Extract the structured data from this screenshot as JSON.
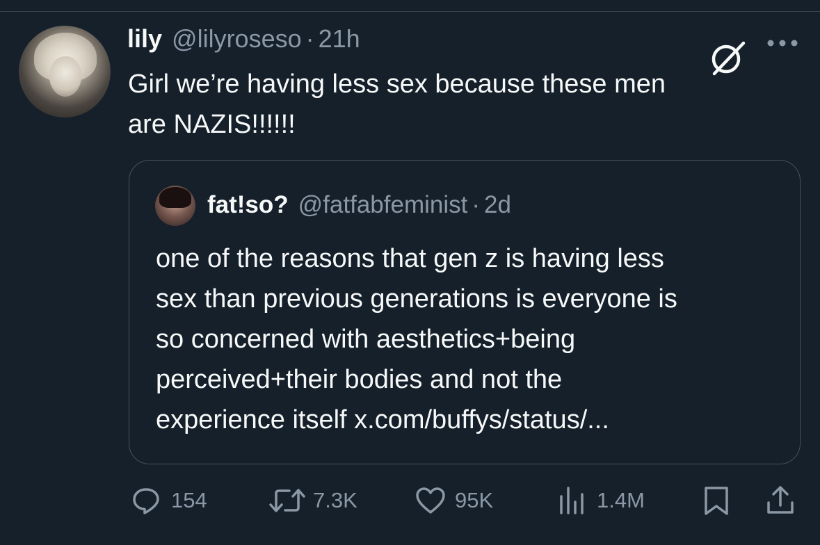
{
  "tweet": {
    "display_name": "lily",
    "handle": "@lilyroseso",
    "separator": "·",
    "time": "21h",
    "text_line1": "Girl we’re having less sex because these men",
    "text_line2": "are NAZIS!!!!!!"
  },
  "quote": {
    "display_name": "fat!so?",
    "handle": "@fatfabfeminist",
    "separator": "·",
    "time": "2d",
    "lines": [
      "one of the reasons that gen z is having less",
      "sex than previous generations is everyone is",
      "so concerned with aesthetics+being",
      "perceived+their bodies and not the",
      "experience itself x.com/buffys/status/..."
    ]
  },
  "actions": {
    "replies": "154",
    "reposts": "7.3K",
    "likes": "95K",
    "views": "1.4M"
  },
  "icons": {
    "grok": "grok-icon",
    "more": "more-icon",
    "reply": "reply-icon",
    "repost": "repost-icon",
    "like": "heart-icon",
    "views": "views-icon",
    "bookmark": "bookmark-icon",
    "share": "share-icon"
  },
  "colors": {
    "background": "#15202b",
    "text": "#f7f9f9",
    "secondary": "#8b98a5",
    "border": "#425260"
  }
}
